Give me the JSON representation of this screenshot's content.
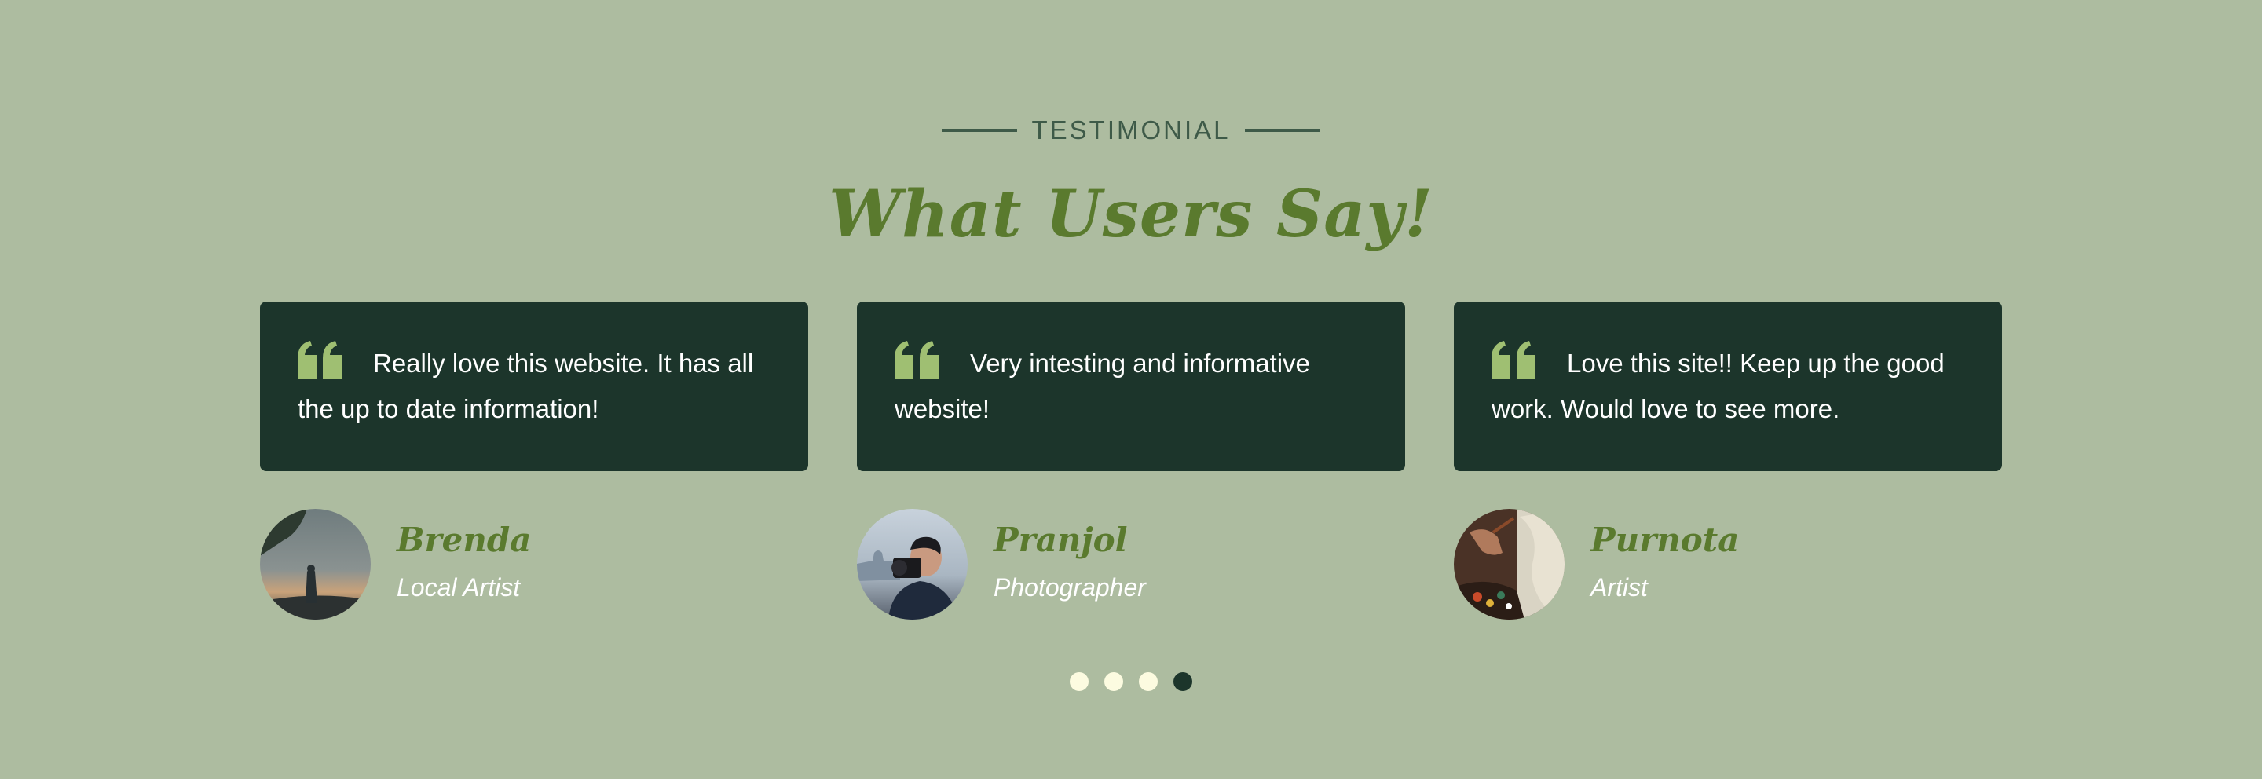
{
  "section": {
    "eyebrow": "TESTIMONIAL",
    "title": "What Users Say!"
  },
  "colors": {
    "background": "#adbca0",
    "card": "#1c352b",
    "accent_green": "#5a7a2e",
    "quote_icon": "#9fbf72",
    "dot_inactive": "#fcfbe0",
    "dot_active": "#1c352b"
  },
  "testimonials": [
    {
      "quote": "Really love this website. It has all the up to date information!",
      "name": "Brenda",
      "role": "Local Artist",
      "avatar_icon": "person-at-sunset-photo"
    },
    {
      "quote": "Very intesting and informative website!",
      "name": "Pranjol",
      "role": "Photographer",
      "avatar_icon": "man-with-camera-photo"
    },
    {
      "quote": "Love this site!! Keep up the good work. Would love to see more.",
      "name": "Purnota",
      "role": "Artist",
      "avatar_icon": "painter-hands-photo"
    }
  ],
  "pagination": {
    "total": 4,
    "active_index": 3
  }
}
